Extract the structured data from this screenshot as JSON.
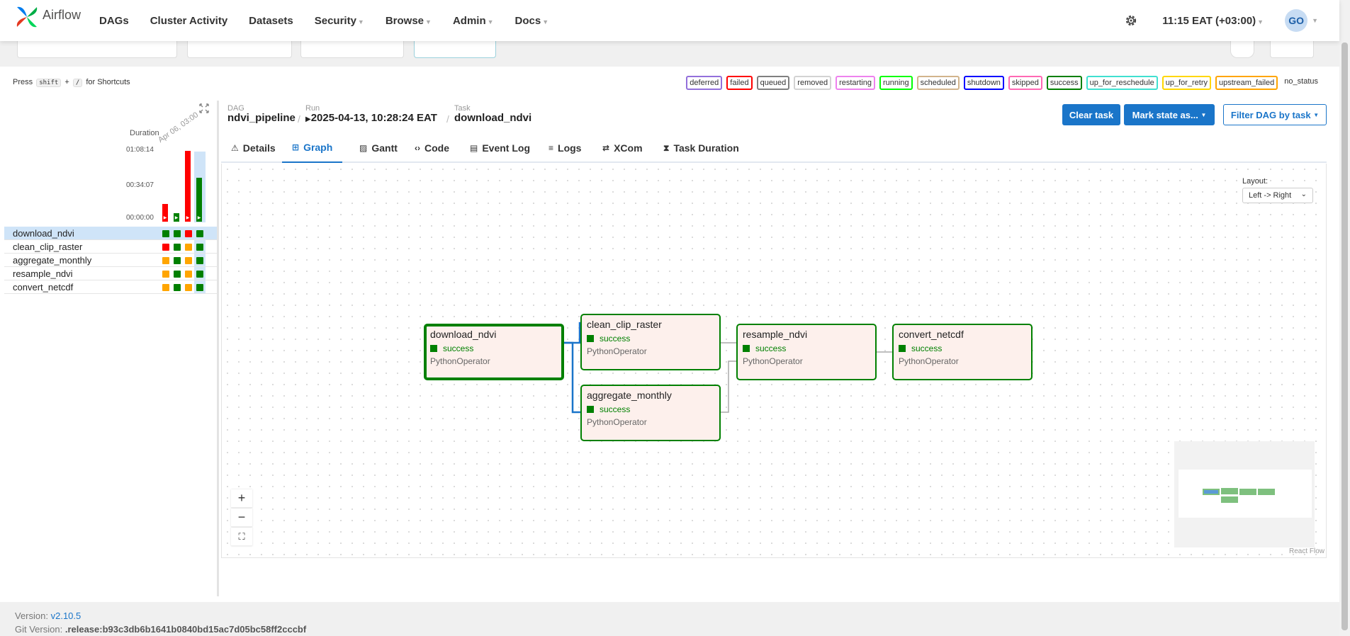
{
  "brand": {
    "name": "Airflow"
  },
  "nav": {
    "items": [
      {
        "label": "DAGs",
        "dropdown": false
      },
      {
        "label": "Cluster Activity",
        "dropdown": false
      },
      {
        "label": "Datasets",
        "dropdown": false
      },
      {
        "label": "Security",
        "dropdown": true
      },
      {
        "label": "Browse",
        "dropdown": true
      },
      {
        "label": "Admin",
        "dropdown": true
      },
      {
        "label": "Docs",
        "dropdown": true
      }
    ],
    "clock": "11:15 EAT (+03:00)",
    "user_initials": "GO"
  },
  "shortcut": {
    "press": "Press",
    "key1": "shift",
    "plus": "+",
    "key2": "/",
    "suffix": "for Shortcuts"
  },
  "legend": [
    {
      "label": "deferred",
      "color": "#9370db"
    },
    {
      "label": "failed",
      "color": "#ff0000"
    },
    {
      "label": "queued",
      "color": "#808080"
    },
    {
      "label": "removed",
      "color": "#d3d3d3"
    },
    {
      "label": "restarting",
      "color": "#ee82ee"
    },
    {
      "label": "running",
      "color": "#00ff00"
    },
    {
      "label": "scheduled",
      "color": "#d2b48c"
    },
    {
      "label": "shutdown",
      "color": "#0000ff"
    },
    {
      "label": "skipped",
      "color": "#ff69b4"
    },
    {
      "label": "success",
      "color": "#008000"
    },
    {
      "label": "up_for_reschedule",
      "color": "#40e0d0"
    },
    {
      "label": "up_for_retry",
      "color": "#ffd700"
    },
    {
      "label": "upstream_failed",
      "color": "#ffa500"
    },
    {
      "label": "no_status",
      "color": ""
    }
  ],
  "grid": {
    "duration_label": "Duration",
    "date_label": "Apr 06, 03:00",
    "y_ticks": [
      "01:08:14",
      "00:34:07",
      "00:00:00"
    ],
    "runs": [
      {
        "state": "failed",
        "duration_fraction": 0.25
      },
      {
        "state": "success",
        "duration_fraction": 0.12
      },
      {
        "state": "failed",
        "duration_fraction": 1.0
      },
      {
        "state": "success",
        "duration_fraction": 0.62
      }
    ],
    "tasks": [
      {
        "name": "download_ndvi",
        "selected": true,
        "states": [
          "#008000",
          "#008000",
          "#ff0000",
          "#008000"
        ]
      },
      {
        "name": "clean_clip_raster",
        "selected": false,
        "states": [
          "#ff0000",
          "#008000",
          "#ffa500",
          "#008000"
        ]
      },
      {
        "name": "aggregate_monthly",
        "selected": false,
        "states": [
          "#ffa500",
          "#008000",
          "#ffa500",
          "#008000"
        ]
      },
      {
        "name": "resample_ndvi",
        "selected": false,
        "states": [
          "#ffa500",
          "#008000",
          "#ffa500",
          "#008000"
        ]
      },
      {
        "name": "convert_netcdf",
        "selected": false,
        "states": [
          "#ffa500",
          "#008000",
          "#ffa500",
          "#008000"
        ]
      }
    ]
  },
  "breadcrumb": {
    "dag_label": "DAG",
    "dag_value": "ndvi_pipeline",
    "run_label": "Run",
    "run_value": "2025-04-13, 10:28:24 EAT",
    "task_label": "Task",
    "task_value": "download_ndvi"
  },
  "actions": {
    "clear_task": "Clear task",
    "mark_state": "Mark state as...",
    "filter_dag": "Filter DAG by task"
  },
  "tabs": [
    {
      "label": "Details",
      "icon": "⚠"
    },
    {
      "label": "Graph",
      "icon": "⊞",
      "active": true
    },
    {
      "label": "Gantt",
      "icon": "▨"
    },
    {
      "label": "Code",
      "icon": "‹›"
    },
    {
      "label": "Event Log",
      "icon": "▤"
    },
    {
      "label": "Logs",
      "icon": "≡"
    },
    {
      "label": "XCom",
      "icon": "⇄"
    },
    {
      "label": "Task Duration",
      "icon": "⧗"
    }
  ],
  "graph": {
    "layout_label": "Layout:",
    "layout_value": "Left -> Right",
    "nodes": [
      {
        "name": "download_ndvi",
        "state": "success",
        "operator": "PythonOperator"
      },
      {
        "name": "clean_clip_raster",
        "state": "success",
        "operator": "PythonOperator"
      },
      {
        "name": "aggregate_monthly",
        "state": "success",
        "operator": "PythonOperator"
      },
      {
        "name": "resample_ndvi",
        "state": "success",
        "operator": "PythonOperator"
      },
      {
        "name": "convert_netcdf",
        "state": "success",
        "operator": "PythonOperator"
      }
    ],
    "zoom": {
      "in": "+",
      "out": "−",
      "fit": "⛶"
    },
    "attribution": "React Flow"
  },
  "footer": {
    "version_label": "Version:",
    "version_value": "v2.10.5",
    "git_label": "Git Version:",
    "git_value": ".release:b93c3db6b1641b0840bd15ac7d05bc58ff2cccbf"
  }
}
